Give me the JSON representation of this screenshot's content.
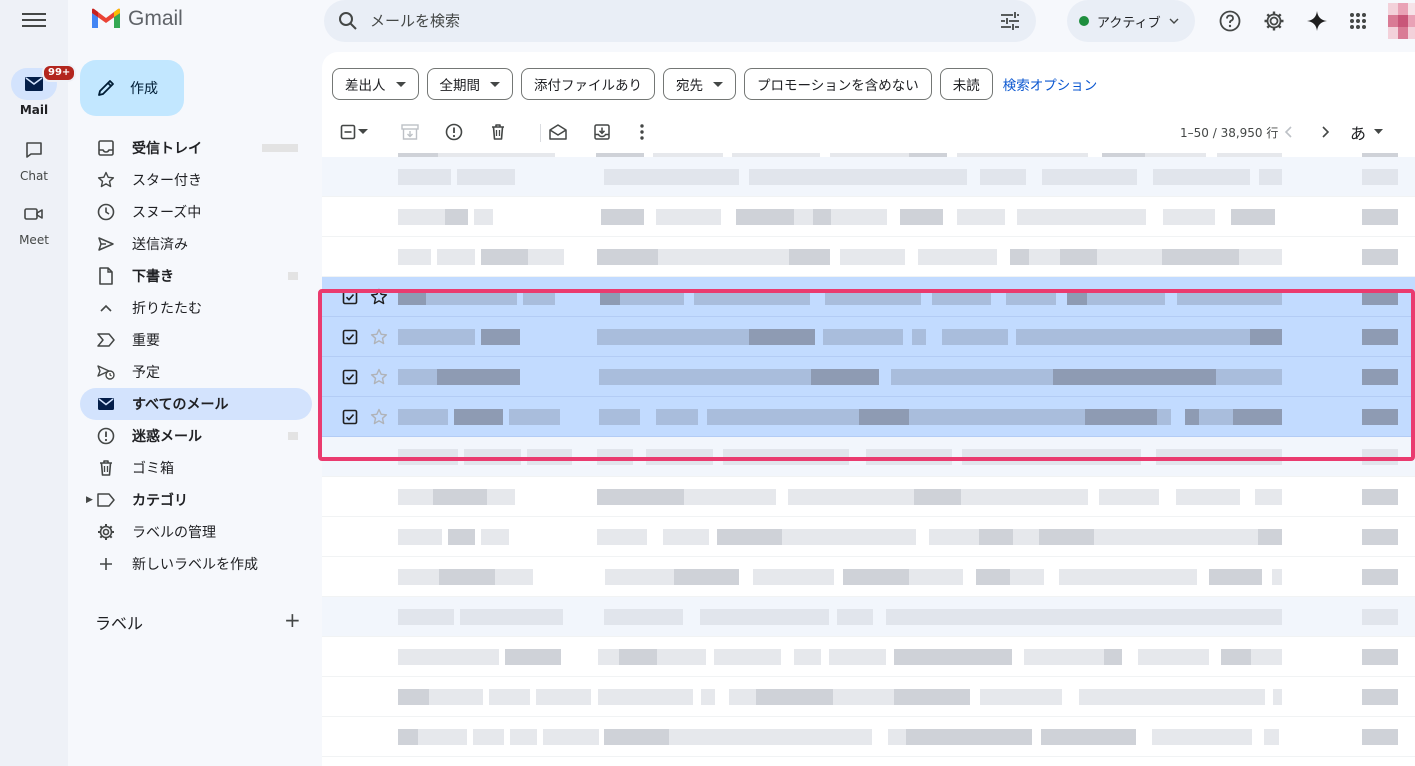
{
  "app": {
    "title": "Gmail"
  },
  "rail": {
    "items": [
      {
        "label": "Mail",
        "badge": "99+",
        "icon": "mail-icon"
      },
      {
        "label": "Chat",
        "icon": "chat-icon"
      },
      {
        "label": "Meet",
        "icon": "video-icon"
      }
    ]
  },
  "search": {
    "placeholder": "メールを検索"
  },
  "status": {
    "label": "アクティブ",
    "color": "#1e8e3e"
  },
  "compose": {
    "label": "作成"
  },
  "nav": {
    "items": [
      {
        "label": "受信トレイ",
        "icon": "inbox-icon"
      },
      {
        "label": "スター付き",
        "icon": "star-icon"
      },
      {
        "label": "スヌーズ中",
        "icon": "clock-icon"
      },
      {
        "label": "送信済み",
        "icon": "send-icon"
      },
      {
        "label": "下書き",
        "icon": "draft-icon"
      },
      {
        "label": "折りたたむ",
        "icon": "chevron-up-icon"
      },
      {
        "label": "重要",
        "icon": "important-icon"
      },
      {
        "label": "予定",
        "icon": "scheduled-icon"
      },
      {
        "label": "すべてのメール",
        "icon": "all-mail-icon"
      },
      {
        "label": "迷惑メール",
        "icon": "spam-icon"
      },
      {
        "label": "ゴミ箱",
        "icon": "trash-icon"
      },
      {
        "label": "カテゴリ",
        "icon": "label-icon"
      },
      {
        "label": "ラベルの管理",
        "icon": "gear-icon"
      },
      {
        "label": "新しいラベルを作成",
        "icon": "plus-icon"
      }
    ],
    "labels_heading": "ラベル"
  },
  "filters": {
    "chips": [
      "差出人",
      "全期間",
      "添付ファイルあり",
      "宛先",
      "プロモーションを含めない",
      "未読"
    ],
    "advanced_link": "検索オプション"
  },
  "toolbar": {
    "pagination": "1–50 / 38,950 行",
    "input_tool": "あ"
  },
  "colors": {
    "selection": "#c2dbff",
    "highlight_border": "#ea3b6f",
    "accent": "#0b57d0"
  }
}
